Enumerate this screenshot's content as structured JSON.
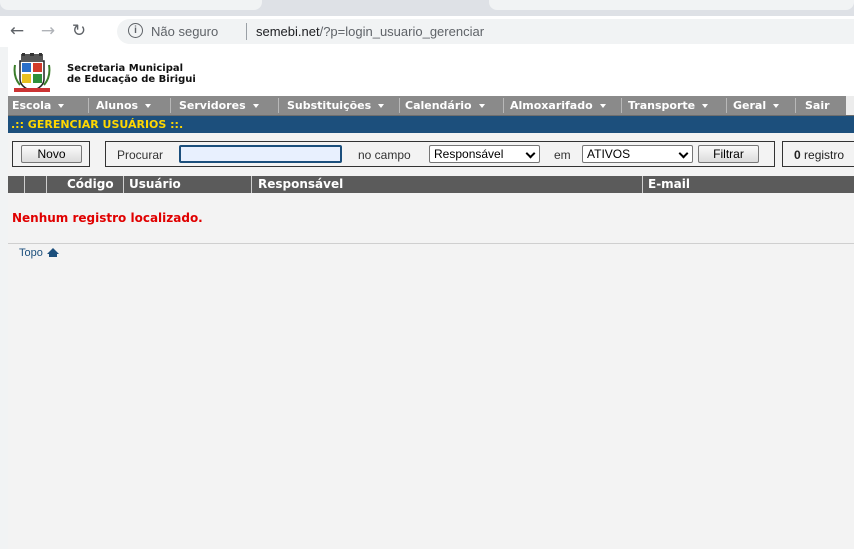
{
  "browser": {
    "security_label": "Não seguro",
    "url_host": "semebi.net",
    "url_path": "/?p=login_usuario_gerenciar"
  },
  "header": {
    "org_line1": "Secretaria Municipal",
    "org_line2": "de Educação de Birigui"
  },
  "menu": [
    {
      "label": "Escola"
    },
    {
      "label": "Alunos"
    },
    {
      "label": "Servidores"
    },
    {
      "label": "Substituições"
    },
    {
      "label": "Calendário"
    },
    {
      "label": "Almoxarifado"
    },
    {
      "label": "Transporte"
    },
    {
      "label": "Geral"
    },
    {
      "label": "Sair"
    }
  ],
  "section_title": ".:: GERENCIAR USUÁRIOS ::.",
  "filters": {
    "new_button": "Novo",
    "search_label": "Procurar",
    "search_value": "",
    "field_label": "no campo",
    "field_selected": "Responsável",
    "status_label": "em",
    "status_selected": "ATIVOS",
    "filter_button": "Filtrar",
    "count_value": "0",
    "count_label": "registro"
  },
  "table": {
    "columns": [
      "Código",
      "Usuário",
      "Responsável",
      "E-mail"
    ],
    "empty_message": "Nenhum registro localizado."
  },
  "footer": {
    "top_link": "Topo"
  }
}
